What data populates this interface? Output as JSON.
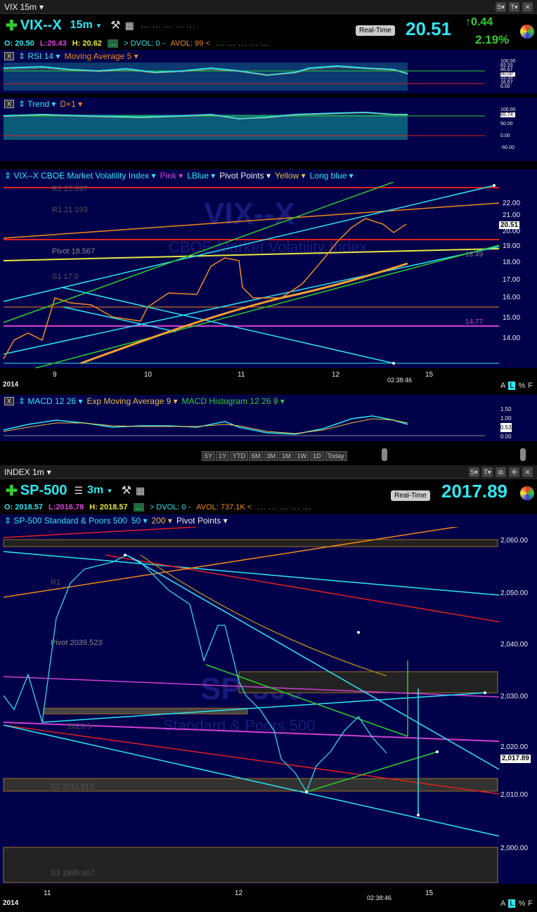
{
  "vix": {
    "title": "VIX 15m",
    "symbol": "VIX--X",
    "interval": "15m",
    "realtime": "Real-Time",
    "last": "20.51",
    "change": "0.44",
    "change_pct": "2.19%",
    "open": "O: 20.50",
    "low": "L:20.43",
    "high": "H: 20.62",
    "dvol": "> DVOL: 0   -",
    "avol": "AVOL: 99 <",
    "rsi_study": "RSI 14",
    "rsi_ma": "Moving Average 5",
    "rsi_ticks": [
      "100.00",
      "83.33",
      "66.67",
      "50.00",
      "33.33",
      "16.67",
      "0.00"
    ],
    "trend_study": "Trend",
    "trend_sub": "D+1",
    "trend_ticks": [
      "100.00",
      "65.74",
      "50.00",
      "0.00",
      "-50.00"
    ],
    "main_study": "VIX--X CBOE Market Volatility Index",
    "main_opts": [
      "Pink",
      "LBlue",
      "Pivot Points",
      "Yellow",
      "Long blue"
    ],
    "price_ticks": [
      "22.00",
      "21.00",
      "20.00",
      "19.00",
      "18.00",
      "17.00",
      "16.00",
      "15.00",
      "14.00"
    ],
    "price_label": "20.51",
    "pivot_labels": [
      "R2 22.697",
      "R1 21.193",
      "Pivot 18.567",
      "S1 17.0",
      "14.77",
      "18.49"
    ],
    "watermark": "VIX--X",
    "watermark2": "CBOE Market Volatility Index",
    "dates": [
      "9",
      "10",
      "11",
      "12",
      "15"
    ],
    "year": "2014",
    "time": "02:38:46",
    "alpf": [
      "A",
      "L",
      "%",
      "F"
    ],
    "macd_study": "MACD 12 26",
    "macd_ema": "Exp Moving Average 9",
    "macd_hist": "MACD Histogram 12 26 9",
    "macd_ticks": [
      "1.50",
      "1.00",
      "0.53",
      "0.00"
    ],
    "timeframes": [
      "5Y",
      "1Y",
      "YTD",
      "6M",
      "3M",
      "1M",
      "1W",
      "1D",
      "Today"
    ]
  },
  "sp": {
    "title": "INDEX 1m",
    "symbol": "SP-500",
    "interval": "3m",
    "realtime": "Real-Time",
    "last": "2017.89",
    "open": "O: 2018.57",
    "low": "L:2016.78",
    "high": "H: 2018.57",
    "dvol": "> DVOL: 0   -",
    "avol": "AVOL: 737.1K <",
    "study": "SP-500 Standard & Poors 500",
    "study_opts": [
      "50",
      "200",
      "Pivot Points"
    ],
    "price_ticks": [
      "2,060.00",
      "2,050.00",
      "2,040.00",
      "2,030.00",
      "2,020.00",
      "2,017.89",
      "2,010.00",
      "2,000.00"
    ],
    "pivot_labels": [
      "Pivot 2039.523",
      "S2 2011.913",
      "S3 1995.907",
      "R1",
      "2023.5"
    ],
    "watermark": "SP-500",
    "watermark2": "Standard & Poors 500",
    "dates": [
      "11",
      "12",
      "15"
    ],
    "year": "2014",
    "time": "02:38:46",
    "alpf": [
      "A",
      "L",
      "%",
      "F"
    ]
  },
  "colors": {
    "cyan": "#2ee6f2",
    "orange": "#f08a1c",
    "green": "#33cc33",
    "red": "#e02020",
    "magenta": "#d040d0",
    "yellow": "#e8e840",
    "navy": "#00004a"
  }
}
